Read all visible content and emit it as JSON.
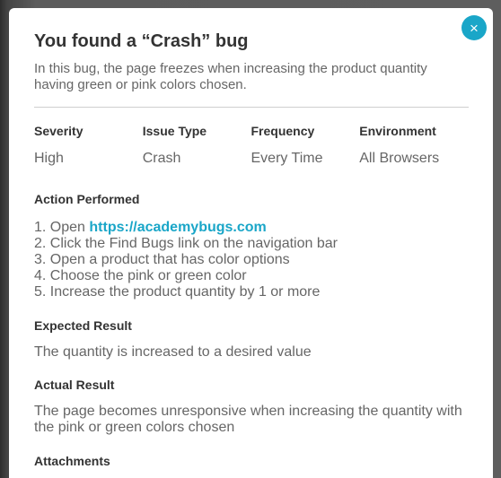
{
  "modal": {
    "close_icon": "×",
    "title": "You found a “Crash” bug",
    "description": "In this bug, the page freezes when increasing the product quantity having green or pink colors chosen."
  },
  "meta": {
    "severity": {
      "label": "Severity",
      "value": "High"
    },
    "issue_type": {
      "label": "Issue Type",
      "value": "Crash"
    },
    "frequency": {
      "label": "Frequency",
      "value": "Every Time"
    },
    "environment": {
      "label": "Environment",
      "value": "All Browsers"
    }
  },
  "action": {
    "heading": "Action Performed",
    "steps": [
      {
        "num": "1. ",
        "text": "Open ",
        "link": "https://academybugs.com"
      },
      {
        "num": "2. ",
        "text": "Click the Find Bugs link on the navigation bar"
      },
      {
        "num": "3. ",
        "text": "Open a product that has color options"
      },
      {
        "num": "4. ",
        "text": "Choose the pink or green color"
      },
      {
        "num": "5. ",
        "text": "Increase the product quantity by 1 or more"
      }
    ]
  },
  "expected": {
    "heading": "Expected Result",
    "text": "The quantity is increased to a desired value"
  },
  "actual": {
    "heading": "Actual Result",
    "text": "The page becomes unresponsive when increasing the quantity with the pink or green colors chosen"
  },
  "attachments": {
    "heading": "Attachments"
  },
  "colors": {
    "accent": "#1aa6c8",
    "heading_text": "#333333",
    "body_text": "#666666"
  }
}
